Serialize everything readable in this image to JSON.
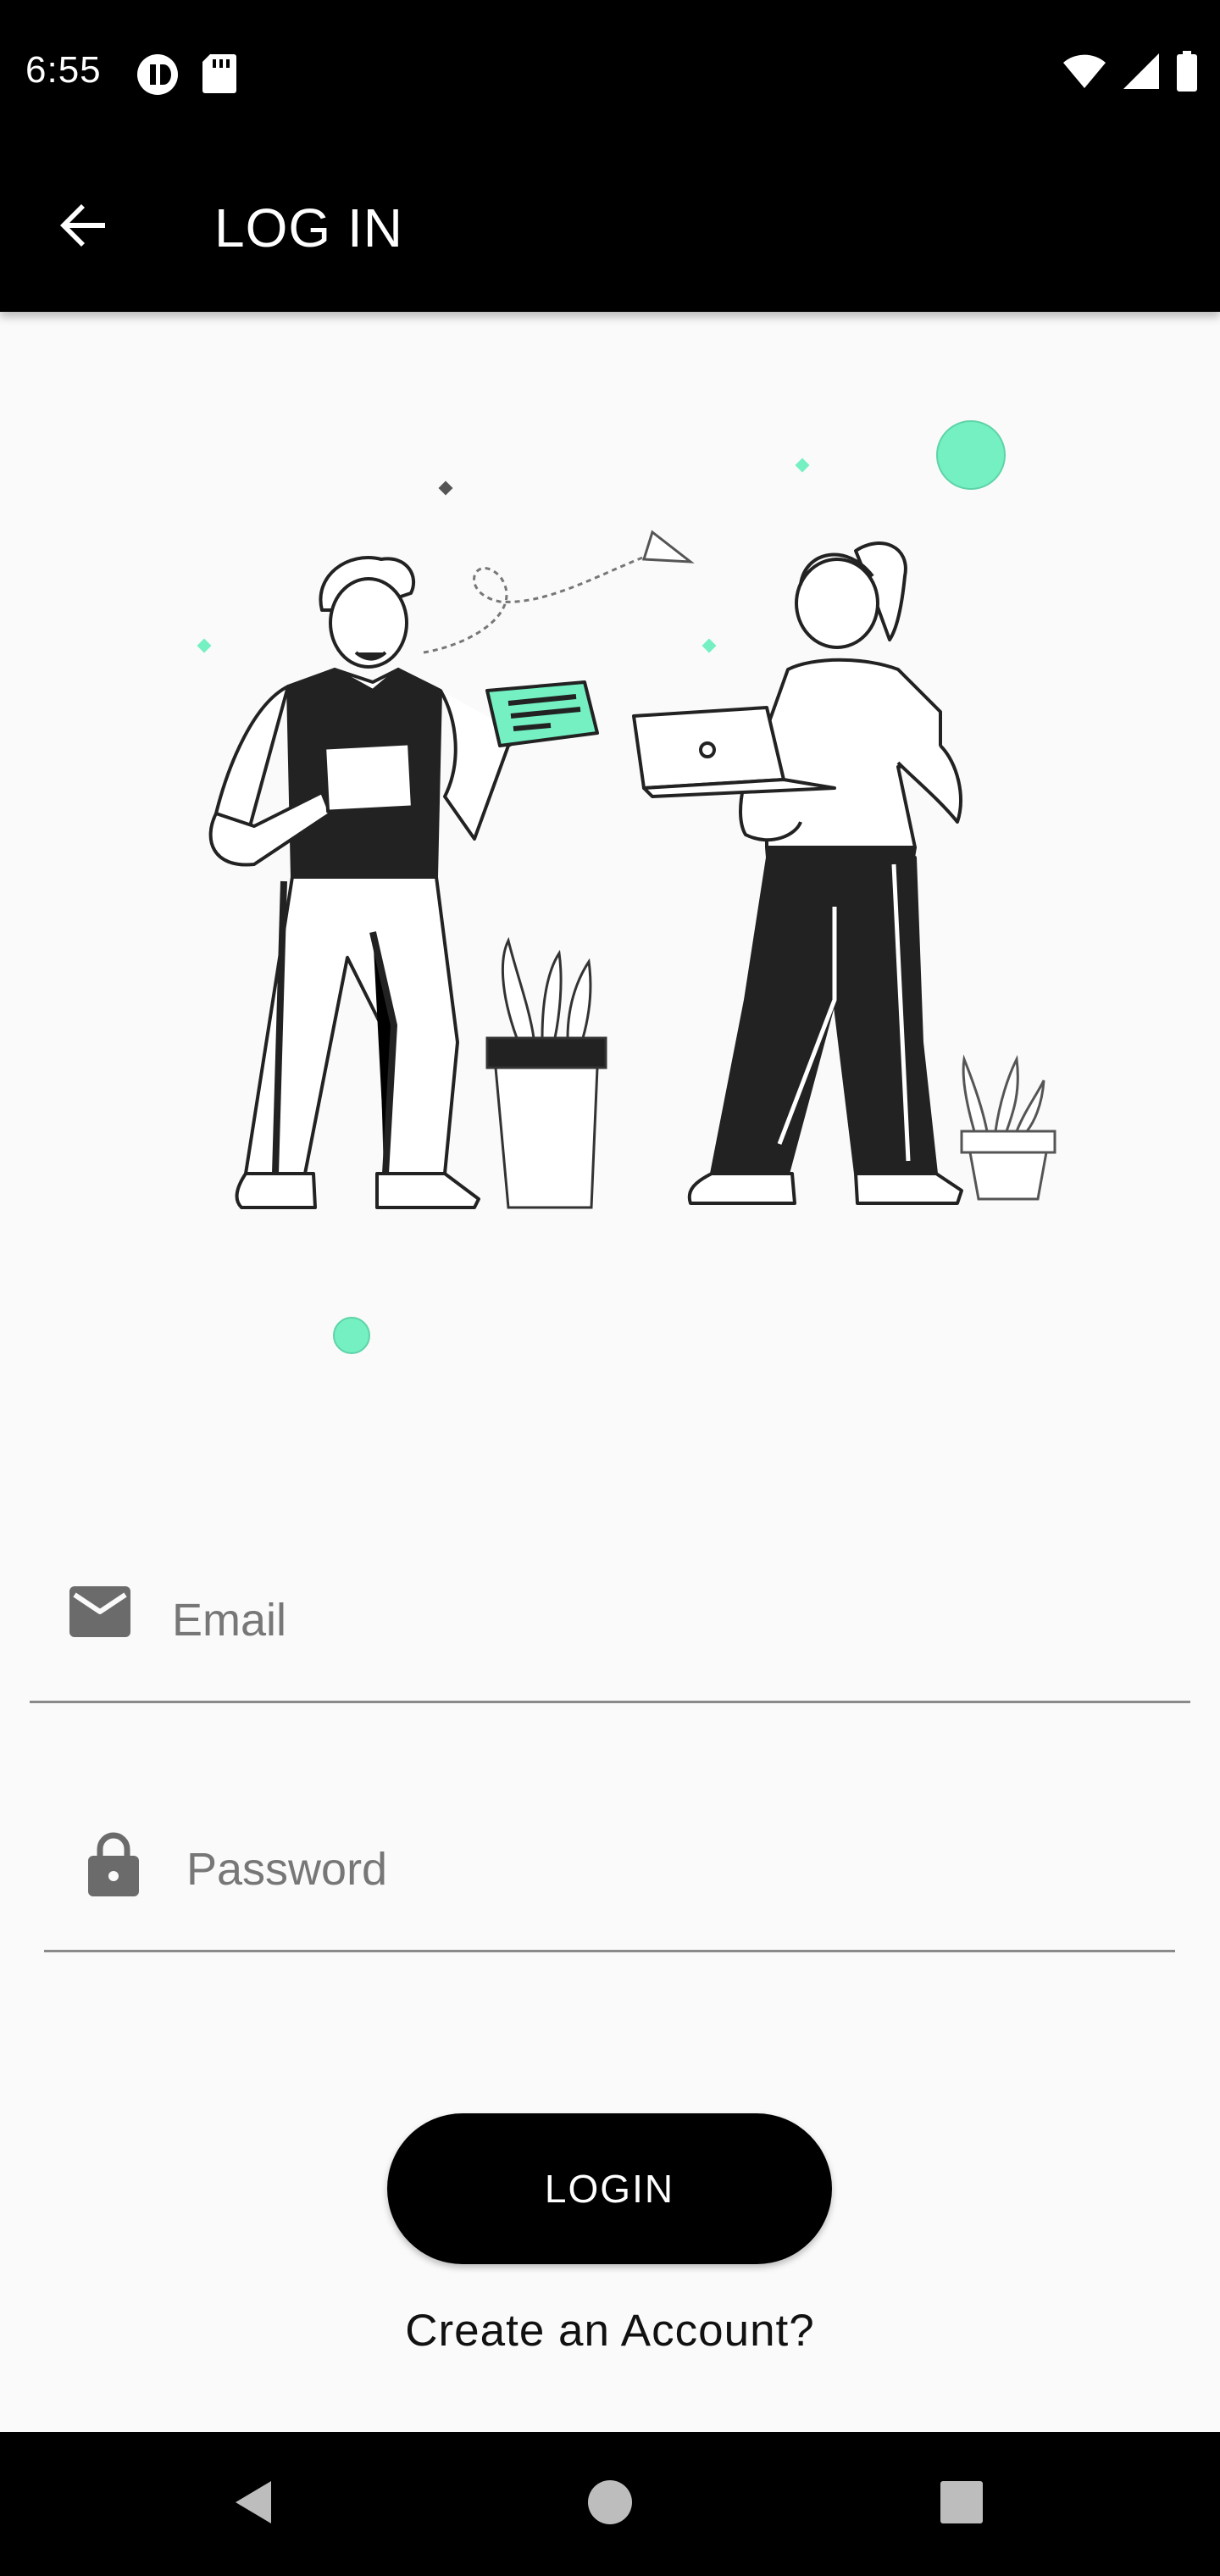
{
  "status_bar": {
    "time": "6:55",
    "left_icons": [
      "vpn-key-icon",
      "sd-card-icon"
    ],
    "right_icons": [
      "wifi-icon",
      "signal-icon",
      "battery-icon"
    ]
  },
  "app_bar": {
    "back_icon": "arrow-back-icon",
    "title": "LOG IN"
  },
  "illustration": {
    "description_icon": "two-people-collaborating-illustration",
    "accent_color": "#74f0c3"
  },
  "form": {
    "email": {
      "icon": "email-icon",
      "placeholder": "Email",
      "value": ""
    },
    "password": {
      "icon": "lock-icon",
      "placeholder": "Password",
      "value": ""
    },
    "login_label": "LOGIN",
    "create_account_label": "Create an Account?"
  },
  "nav_bar": {
    "buttons": [
      "back-triangle-icon",
      "home-circle-icon",
      "recents-square-icon"
    ]
  },
  "colors": {
    "bar_bg": "#000000",
    "page_bg": "#fafafa",
    "accent": "#74f0c3",
    "icon_grey": "#6b6b6b"
  }
}
